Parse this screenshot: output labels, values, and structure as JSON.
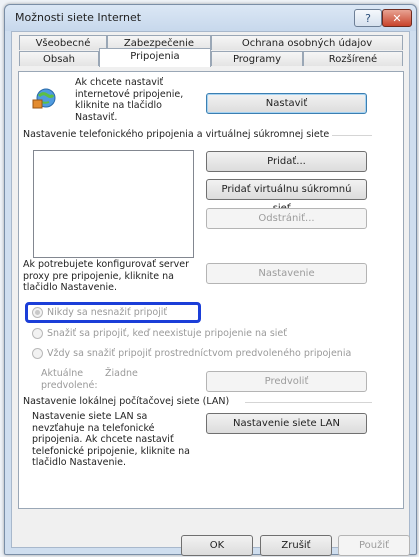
{
  "window": {
    "title": "Možnosti siete Internet",
    "help": "?",
    "close": "✕"
  },
  "tabs_row1": [
    "Všeobecné",
    "Zabezpečenie",
    "Ochrana osobných údajov"
  ],
  "tabs_row2": [
    "Obsah",
    "Pripojenia",
    "Programy",
    "Rozšírené"
  ],
  "setup": {
    "text": "Ak chcete nastaviť internetové pripojenie, kliknite na tlačidlo Nastaviť.",
    "button": "Nastaviť"
  },
  "dialup": {
    "header": "Nastavenie telefonického pripojenia a virtuálnej súkromnej siete",
    "add": "Pridať...",
    "add_vpn": "Pridať virtuálnu súkromnú sieť...",
    "remove": "Odstrániť...",
    "settings": "Nastavenie",
    "proxy_text": "Ak potrebujete konfigurovať server proxy pre pripojenie, kliknite na tlačidlo Nastavenie.",
    "radio_never": "Nikdy sa nesnažiť pripojiť",
    "radio_when_none": "Snažiť sa pripojiť, keď neexistuje pripojenie na sieť",
    "radio_always": "Vždy sa snažiť pripojiť prostredníctvom predvoleného pripojenia",
    "current_label": "Aktuálne predvolené:",
    "current_value": "Žiadne",
    "set_default": "Predvoliť"
  },
  "lan": {
    "header": "Nastavenie lokálnej počítačovej siete (LAN)",
    "text": "Nastavenie siete LAN sa nevzťahuje na telefonické pripojenia. Ak chcete nastaviť telefonické pripojenie, kliknite na tlačidlo Nastavenie.",
    "button": "Nastavenie siete LAN"
  },
  "footer": {
    "ok": "OK",
    "cancel": "Zrušiť",
    "apply": "Použiť"
  }
}
